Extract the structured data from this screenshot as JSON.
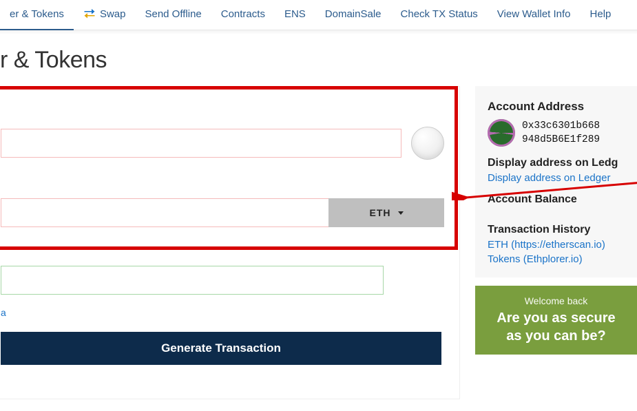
{
  "nav": {
    "items": [
      {
        "label": "er & Tokens",
        "active": true
      },
      {
        "label": "Swap"
      },
      {
        "label": "Send Offline"
      },
      {
        "label": "Contracts"
      },
      {
        "label": "ENS"
      },
      {
        "label": "DomainSale"
      },
      {
        "label": "Check TX Status"
      },
      {
        "label": "View Wallet Info"
      },
      {
        "label": "Help"
      }
    ]
  },
  "page": {
    "title": "r & Tokens"
  },
  "form": {
    "address_value": "",
    "amount_value": "",
    "currency_label": "ETH",
    "gas_value": "",
    "advanced_link": "a",
    "generate_button": "Generate Transaction"
  },
  "sidebar": {
    "account_address_heading": "Account Address",
    "address_line1": "0x33c6301b668",
    "address_line2": "948d5B6E1f289",
    "display_ledger_heading": "Display address on Ledg",
    "display_ledger_link": "Display address on Ledger",
    "balance_heading": "Account Balance",
    "history_heading": "Transaction History",
    "history_links": [
      "ETH (https://etherscan.io)",
      "Tokens (Ethplorer.io)"
    ]
  },
  "cta": {
    "small": "Welcome back",
    "big": "Are you as secure as you can be?"
  }
}
